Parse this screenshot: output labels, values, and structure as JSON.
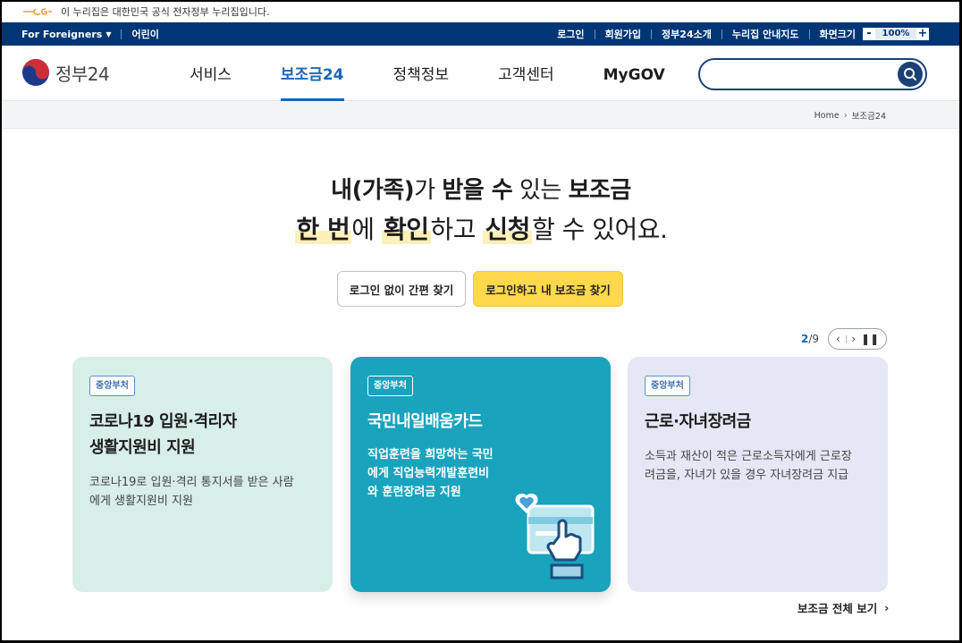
{
  "gov_banner": {
    "text": "이 누리집은 대한민국 공식 전자정부 누리집입니다.",
    "icon": "eg-logo-icon"
  },
  "topbar": {
    "left": [
      "For Foreigners",
      "어린이"
    ],
    "right": [
      "로그인",
      "회원가입",
      "정부24소개",
      "누리집 안내지도",
      "화면크기"
    ],
    "zoom": {
      "minus": "-",
      "value": "100%",
      "plus": "+"
    }
  },
  "header": {
    "logo_text": "정부24",
    "nav": [
      "서비스",
      "보조금24",
      "정책정보",
      "고객센터",
      "MyGOV"
    ],
    "active_nav": "보조금24",
    "search_placeholder": ""
  },
  "breadcrumb": [
    "Home",
    "보조금24"
  ],
  "hero": {
    "line1": [
      {
        "text": "내(가족)",
        "bold": true
      },
      {
        "text": "가 ",
        "bold": false
      },
      {
        "text": "받을 수",
        "bold": true
      },
      {
        "text": " 있는 ",
        "bold": false
      },
      {
        "text": "보조금",
        "bold": true
      }
    ],
    "line2": [
      {
        "text": "한 번",
        "bold": true,
        "hl": true
      },
      {
        "text": "에 ",
        "bold": false
      },
      {
        "text": "확인",
        "bold": true,
        "hl": true
      },
      {
        "text": "하고 ",
        "bold": false
      },
      {
        "text": "신청",
        "bold": true,
        "hl": true
      },
      {
        "text": "할 수 있어요.",
        "bold": false
      }
    ]
  },
  "buttons": {
    "guest": "로그인 없이 간편 찾기",
    "login": "로그인하고 내 보조금 찾기"
  },
  "pager": {
    "current": "2",
    "total": "9",
    "separator": "/"
  },
  "cards": [
    {
      "badge": "중앙부처",
      "title": "코로나19 입원·격리자\n생활지원비 지원",
      "desc": "코로나19로 입원·격리 통지서를 받은 사람\n에게 생활지원비 지원"
    },
    {
      "badge": "중앙부처",
      "title": "국민내일배움카드",
      "desc": "직업훈련을 희망하는 국민\n에게 직업능력개발훈련비\n와 훈련장려금 지원"
    },
    {
      "badge": "중앙부처",
      "title": "근로·자녀장려금",
      "desc": "소득과 재산이 적은 근로소득자에게 근로장\n려금을, 자녀가 있을 경우 자녀장려금 지급"
    }
  ],
  "more_link": "보조금 전체 보기",
  "colors": {
    "navy": "#003675",
    "accent_blue": "#1a67b6",
    "yellow": "#ffd84c",
    "teal": "#19a3bd",
    "mint": "#d8eee8",
    "lavender": "#e3e8f4"
  }
}
